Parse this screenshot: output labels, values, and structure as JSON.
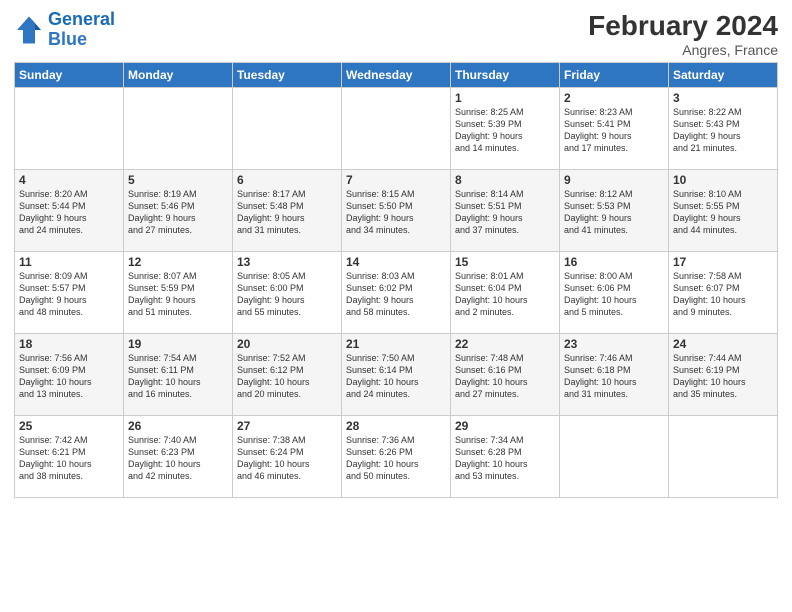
{
  "logo": {
    "line1": "General",
    "line2": "Blue"
  },
  "title": "February 2024",
  "subtitle": "Angres, France",
  "days_of_week": [
    "Sunday",
    "Monday",
    "Tuesday",
    "Wednesday",
    "Thursday",
    "Friday",
    "Saturday"
  ],
  "weeks": [
    [
      {
        "day": "",
        "info": ""
      },
      {
        "day": "",
        "info": ""
      },
      {
        "day": "",
        "info": ""
      },
      {
        "day": "",
        "info": ""
      },
      {
        "day": "1",
        "info": "Sunrise: 8:25 AM\nSunset: 5:39 PM\nDaylight: 9 hours\nand 14 minutes."
      },
      {
        "day": "2",
        "info": "Sunrise: 8:23 AM\nSunset: 5:41 PM\nDaylight: 9 hours\nand 17 minutes."
      },
      {
        "day": "3",
        "info": "Sunrise: 8:22 AM\nSunset: 5:43 PM\nDaylight: 9 hours\nand 21 minutes."
      }
    ],
    [
      {
        "day": "4",
        "info": "Sunrise: 8:20 AM\nSunset: 5:44 PM\nDaylight: 9 hours\nand 24 minutes."
      },
      {
        "day": "5",
        "info": "Sunrise: 8:19 AM\nSunset: 5:46 PM\nDaylight: 9 hours\nand 27 minutes."
      },
      {
        "day": "6",
        "info": "Sunrise: 8:17 AM\nSunset: 5:48 PM\nDaylight: 9 hours\nand 31 minutes."
      },
      {
        "day": "7",
        "info": "Sunrise: 8:15 AM\nSunset: 5:50 PM\nDaylight: 9 hours\nand 34 minutes."
      },
      {
        "day": "8",
        "info": "Sunrise: 8:14 AM\nSunset: 5:51 PM\nDaylight: 9 hours\nand 37 minutes."
      },
      {
        "day": "9",
        "info": "Sunrise: 8:12 AM\nSunset: 5:53 PM\nDaylight: 9 hours\nand 41 minutes."
      },
      {
        "day": "10",
        "info": "Sunrise: 8:10 AM\nSunset: 5:55 PM\nDaylight: 9 hours\nand 44 minutes."
      }
    ],
    [
      {
        "day": "11",
        "info": "Sunrise: 8:09 AM\nSunset: 5:57 PM\nDaylight: 9 hours\nand 48 minutes."
      },
      {
        "day": "12",
        "info": "Sunrise: 8:07 AM\nSunset: 5:59 PM\nDaylight: 9 hours\nand 51 minutes."
      },
      {
        "day": "13",
        "info": "Sunrise: 8:05 AM\nSunset: 6:00 PM\nDaylight: 9 hours\nand 55 minutes."
      },
      {
        "day": "14",
        "info": "Sunrise: 8:03 AM\nSunset: 6:02 PM\nDaylight: 9 hours\nand 58 minutes."
      },
      {
        "day": "15",
        "info": "Sunrise: 8:01 AM\nSunset: 6:04 PM\nDaylight: 10 hours\nand 2 minutes."
      },
      {
        "day": "16",
        "info": "Sunrise: 8:00 AM\nSunset: 6:06 PM\nDaylight: 10 hours\nand 5 minutes."
      },
      {
        "day": "17",
        "info": "Sunrise: 7:58 AM\nSunset: 6:07 PM\nDaylight: 10 hours\nand 9 minutes."
      }
    ],
    [
      {
        "day": "18",
        "info": "Sunrise: 7:56 AM\nSunset: 6:09 PM\nDaylight: 10 hours\nand 13 minutes."
      },
      {
        "day": "19",
        "info": "Sunrise: 7:54 AM\nSunset: 6:11 PM\nDaylight: 10 hours\nand 16 minutes."
      },
      {
        "day": "20",
        "info": "Sunrise: 7:52 AM\nSunset: 6:12 PM\nDaylight: 10 hours\nand 20 minutes."
      },
      {
        "day": "21",
        "info": "Sunrise: 7:50 AM\nSunset: 6:14 PM\nDaylight: 10 hours\nand 24 minutes."
      },
      {
        "day": "22",
        "info": "Sunrise: 7:48 AM\nSunset: 6:16 PM\nDaylight: 10 hours\nand 27 minutes."
      },
      {
        "day": "23",
        "info": "Sunrise: 7:46 AM\nSunset: 6:18 PM\nDaylight: 10 hours\nand 31 minutes."
      },
      {
        "day": "24",
        "info": "Sunrise: 7:44 AM\nSunset: 6:19 PM\nDaylight: 10 hours\nand 35 minutes."
      }
    ],
    [
      {
        "day": "25",
        "info": "Sunrise: 7:42 AM\nSunset: 6:21 PM\nDaylight: 10 hours\nand 38 minutes."
      },
      {
        "day": "26",
        "info": "Sunrise: 7:40 AM\nSunset: 6:23 PM\nDaylight: 10 hours\nand 42 minutes."
      },
      {
        "day": "27",
        "info": "Sunrise: 7:38 AM\nSunset: 6:24 PM\nDaylight: 10 hours\nand 46 minutes."
      },
      {
        "day": "28",
        "info": "Sunrise: 7:36 AM\nSunset: 6:26 PM\nDaylight: 10 hours\nand 50 minutes."
      },
      {
        "day": "29",
        "info": "Sunrise: 7:34 AM\nSunset: 6:28 PM\nDaylight: 10 hours\nand 53 minutes."
      },
      {
        "day": "",
        "info": ""
      },
      {
        "day": "",
        "info": ""
      }
    ]
  ]
}
